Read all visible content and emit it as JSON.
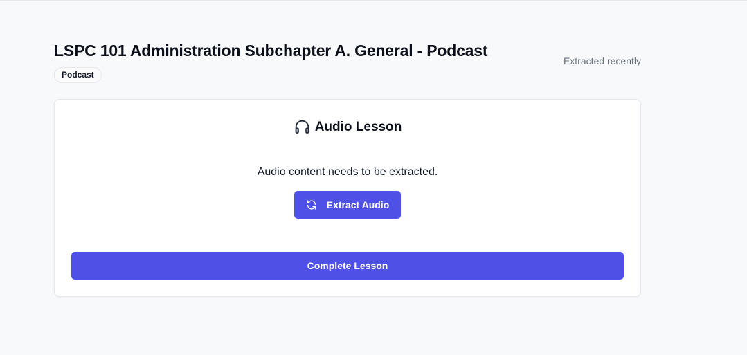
{
  "lesson": {
    "title": "LSPC 101 Administration Subchapter A. General - Podcast",
    "type_badge": "Podcast",
    "status": "Extracted recently"
  },
  "audio_card": {
    "icon": "headphones-icon",
    "title": "Audio Lesson",
    "message": "Audio content needs to be extracted.",
    "extract_button": {
      "icon": "refresh-icon",
      "label": "Extract Audio"
    }
  },
  "actions": {
    "complete_label": "Complete Lesson"
  },
  "colors": {
    "primary": "#4f51e6",
    "background": "#f8f9fb",
    "card": "#ffffff",
    "muted_text": "#6b7280"
  }
}
